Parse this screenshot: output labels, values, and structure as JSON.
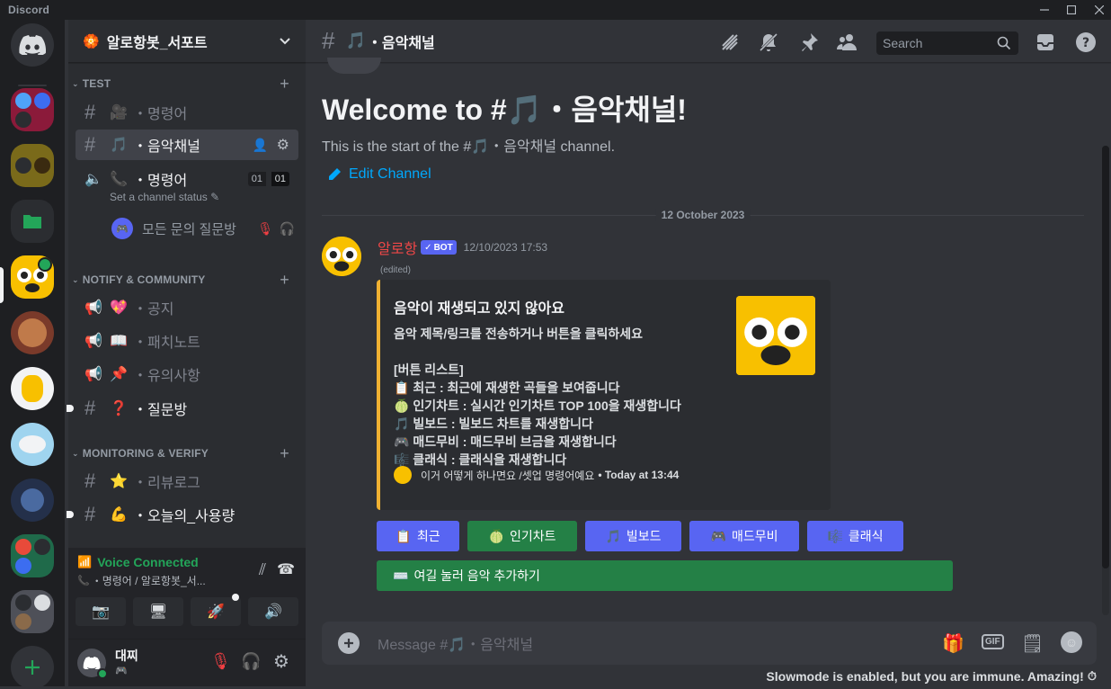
{
  "app": {
    "title": "Discord"
  },
  "server": {
    "name": "알로항봇_서포트"
  },
  "categories": [
    {
      "name": "TEST"
    },
    {
      "name": "NOTIFY & COMMUNITY"
    },
    {
      "name": "MONITORING & VERIFY"
    }
  ],
  "channels": {
    "test_cmd": {
      "emoji": "🎥",
      "name": "・명령어"
    },
    "music": {
      "emoji": "🎵",
      "name": "・음악채널"
    },
    "voice": {
      "emoji": "📞",
      "name": "・명령어",
      "status": "Set a channel status",
      "count_a": "01",
      "count_b": "01"
    },
    "voice_user": {
      "name": "모든 문의 질문방"
    },
    "notice": {
      "emoji": "💖",
      "name": "・공지"
    },
    "patch": {
      "emoji": "📖",
      "name": "・패치노트"
    },
    "caution": {
      "emoji": "📌",
      "name": "・유의사항"
    },
    "question": {
      "emoji": "❓",
      "name": "・질문방"
    },
    "review": {
      "emoji": "⭐",
      "name": "・리뷰로그"
    },
    "usage": {
      "emoji": "💪",
      "name": "・오늘의_사용량"
    }
  },
  "voice_panel": {
    "status": "Voice Connected",
    "location": "・명령어 / 알로항봇_서..."
  },
  "user": {
    "name": "대찌"
  },
  "header": {
    "channel_emoji": "🎵",
    "channel_name": "・음악채널",
    "search_placeholder": "Search"
  },
  "welcome": {
    "title_prefix": "Welcome to #",
    "title_emoji": "🎵",
    "title_suffix": "・음악채널!",
    "sub_prefix": "This is the start of the #",
    "sub_emoji": "🎵",
    "sub_suffix": "・음악채널 channel.",
    "edit_label": "Edit Channel"
  },
  "date_divider": "12 October 2023",
  "message": {
    "author": "알로항",
    "badge": "BOT",
    "timestamp": "12/10/2023 17:53",
    "edited": "(edited)",
    "embed": {
      "title": "음악이 재생되고 있지 않아요",
      "description": "음악 제목/링크를 전송하거나 버튼을 클릭하세요\n\n[버튼 리스트]\n📋 최근 : 최근에 재생한 곡들을 보여줍니다\n🍈 인기차트 : 실시간 인기차트 TOP 100을 재생합니다\n🎵 빌보드 : 빌보드 차트를 재생합니다\n🎮 매드무비 : 매드무비 브금을 재생합니다\n🎼 클래식 : 클래식을 재생합니다",
      "footer_text": "이거 어떻게 하나면요 /셋업 명령어예요",
      "footer_time": "• Today at 13:44"
    },
    "buttons": [
      {
        "emoji": "📋",
        "label": "최근",
        "style": "blurple"
      },
      {
        "emoji": "🍈",
        "label": "인기차트",
        "style": "green"
      },
      {
        "emoji": "🎵",
        "label": "빌보드",
        "style": "blurple"
      },
      {
        "emoji": "🎮",
        "label": "매드무비",
        "style": "blurple"
      },
      {
        "emoji": "🎼",
        "label": "클래식",
        "style": "blurple"
      }
    ],
    "add_button": {
      "emoji": "⌨️",
      "label": "여길 눌러 음악 추가하기"
    }
  },
  "composer": {
    "placeholder": "Message #🎵・음악채널"
  },
  "slowmode": "Slowmode is enabled, but you are immune. Amazing!",
  "colors": {
    "blurple": "#5865f2",
    "green": "#248046",
    "accent_link": "#00a8fc",
    "embed_border": "#f0b132",
    "author": "#f04747"
  }
}
